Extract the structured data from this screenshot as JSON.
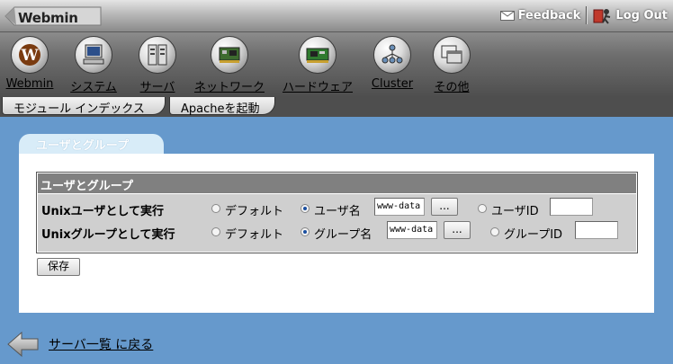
{
  "header": {
    "app_name": "Webmin",
    "feedback_label": "Feedback",
    "logout_label": "Log Out"
  },
  "categories": [
    {
      "label": "Webmin",
      "icon": "webmin-logo-icon"
    },
    {
      "label": "システム",
      "icon": "computer-icon"
    },
    {
      "label": "サーバ",
      "icon": "server-icon"
    },
    {
      "label": "ネットワーク",
      "icon": "network-board-icon"
    },
    {
      "label": "ハードウェア",
      "icon": "hardware-board-icon"
    },
    {
      "label": "Cluster",
      "icon": "cluster-icon"
    },
    {
      "label": "その他",
      "icon": "windows-icon"
    }
  ],
  "subtabs": {
    "module_index": "モジュール インデックス",
    "start_apache": "Apacheを起動"
  },
  "page": {
    "tab_title": "ユーザとグループ",
    "section_title": "ユーザとグループ",
    "save_label": "保存"
  },
  "form": {
    "user_row": {
      "label": "Unixユーザとして実行",
      "default_label": "デフォルト",
      "name_label": "ユーザ名",
      "name_value": "www-data",
      "browse_label": "...",
      "id_label": "ユーザID",
      "id_value": "",
      "selected": "name"
    },
    "group_row": {
      "label": "Unixグループとして実行",
      "default_label": "デフォルト",
      "name_label": "グループ名",
      "name_value": "www-data",
      "browse_label": "...",
      "id_label": "グループID",
      "id_value": "",
      "selected": "name"
    }
  },
  "footer": {
    "back_label": "サーバ一覧 に戻る"
  },
  "colors": {
    "background": "#6699cc",
    "section_header": "#808080",
    "form_body": "#cfcfcf",
    "page_tab": "#d8ecf8"
  }
}
